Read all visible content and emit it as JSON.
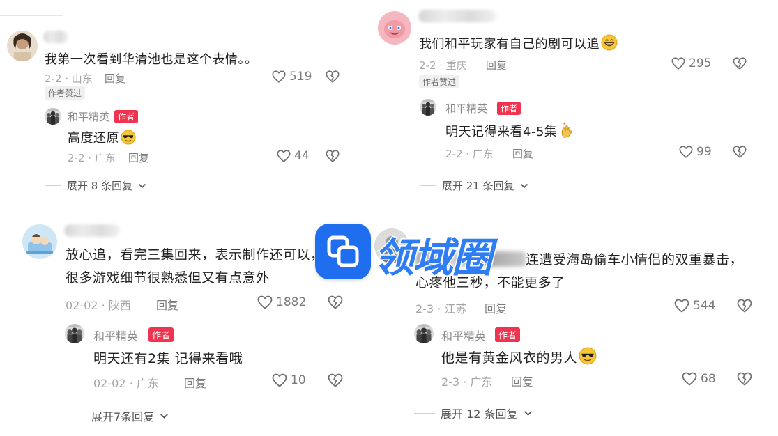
{
  "comments": [
    {
      "id": "c1",
      "text": "我第一次看到华清池也是这个表情。。",
      "date_location": "2-2 · 山东",
      "reply_label": "回复",
      "likes": "519",
      "badge": "作者赞过",
      "reply": {
        "name": "和平精英",
        "author_badge": "作者",
        "text": "高度还原",
        "date_location": "2-2 · 广东",
        "reply_label": "回复",
        "likes": "44"
      },
      "expand": "展开 8 条回复"
    },
    {
      "id": "c2",
      "text": "我们和平玩家有自己的剧可以追",
      "date_location": "2-2 · 重庆",
      "reply_label": "回复",
      "likes": "295",
      "badge": "作者赞过",
      "reply": {
        "name": "和平精英",
        "author_badge": "作者",
        "text": "明天记得来看4-5集",
        "date_location": "2-2 · 广东",
        "reply_label": "回复",
        "likes": "99"
      },
      "expand": "展开 21 条回复"
    },
    {
      "id": "c3",
      "text": "放心追，看完三集回来，表示制作还可以，很多游戏细节很熟悉但又有点意外",
      "date_location": "02-02 · 陕西",
      "reply_label": "回复",
      "likes": "1882",
      "reply": {
        "name": "和平精英",
        "author_badge": "作者",
        "text": "明天还有2集 记得来看哦",
        "date_location": "02-02 · 广东",
        "reply_label": "回复",
        "likes": "10"
      },
      "expand": "展开7条回复"
    },
    {
      "id": "c4",
      "text": "连遭受海岛偷车小情侣的双重暴击，心疼他三秒，不能更多了",
      "date_location": "2-3 · 江苏",
      "reply_label": "回复",
      "likes": "544",
      "reply": {
        "name": "和平精英",
        "author_badge": "作者",
        "text": "他是有黄金风衣的男人",
        "date_location": "2-3 · 广东",
        "reply_label": "回复",
        "likes": "68"
      },
      "expand": "展开 12 条回复"
    }
  ],
  "watermark": {
    "text": "领域圈"
  },
  "colors": {
    "author_badge": "#f0334e",
    "watermark": "#2f7df5",
    "meta": "#a6a6a6"
  },
  "icons": [
    "heart-icon",
    "heart-broken-icon",
    "chevron-down-icon",
    "sunglasses-emoji",
    "grin-emoji",
    "hands-emoji"
  ]
}
